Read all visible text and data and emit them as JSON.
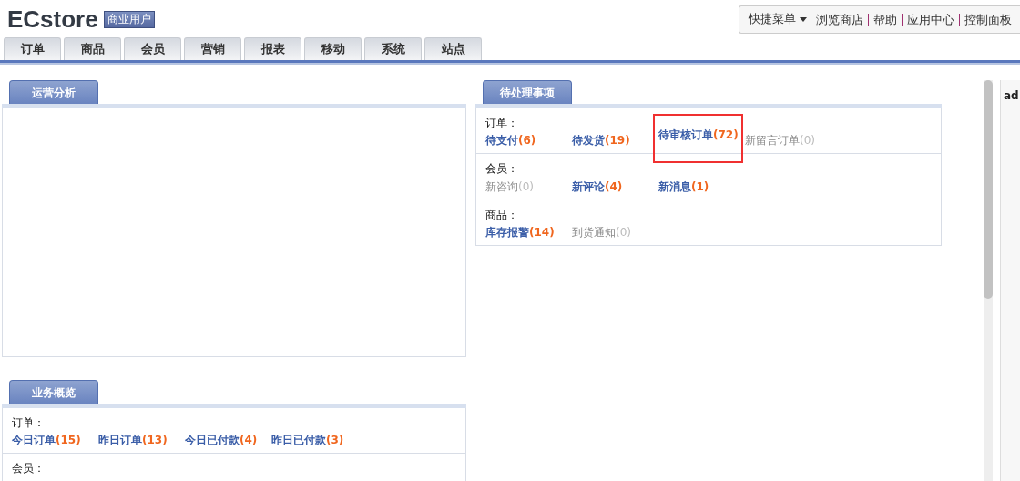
{
  "brand": {
    "name": "ECstore",
    "badge": "商业用户"
  },
  "quick_menu": {
    "label": "快捷菜单"
  },
  "top_links": [
    "浏览商店",
    "帮助",
    "应用中心",
    "控制面板"
  ],
  "tabs": [
    {
      "label": "订单",
      "selected": false
    },
    {
      "label": "商品",
      "selected": false
    },
    {
      "label": "会员",
      "selected": false
    },
    {
      "label": "营销",
      "selected": false
    },
    {
      "label": "报表",
      "selected": false
    },
    {
      "label": "移动",
      "selected": false
    },
    {
      "label": "系统",
      "selected": false
    },
    {
      "label": "站点",
      "selected": false
    }
  ],
  "left_panels": [
    {
      "title": "运营分析"
    },
    {
      "title": "业务概览",
      "sections": [
        {
          "heading": "订单：",
          "items": [
            {
              "label": "今日订单",
              "count": "(15)",
              "active": true,
              "annotated": false
            },
            {
              "label": "昨日订单",
              "count": "(13)",
              "active": true,
              "annotated": false
            },
            {
              "label": "今日已付款",
              "count": "(4)",
              "active": true,
              "annotated": false
            },
            {
              "label": "昨日已付款",
              "count": "(3)",
              "active": true,
              "annotated": false
            }
          ]
        },
        {
          "heading": "会员："
        }
      ]
    }
  ],
  "right_panels": [
    {
      "title": "待处理事项",
      "sections": [
        {
          "heading": "订单：",
          "items": [
            {
              "label": "待支付",
              "count": "(6)",
              "active": true,
              "annotated": false
            },
            {
              "label": "待发货",
              "count": "(19)",
              "active": true,
              "annotated": false
            },
            {
              "label": "待审核订单",
              "count": "(72)",
              "active": true,
              "annotated": true
            },
            {
              "label": "新留言订单",
              "count": "(0)",
              "active": false,
              "annotated": false
            }
          ]
        },
        {
          "heading": "会员：",
          "items": [
            {
              "label": "新咨询",
              "count": "(0)",
              "active": false,
              "annotated": false
            },
            {
              "label": "新评论",
              "count": "(4)",
              "active": true,
              "annotated": false
            },
            {
              "label": "新消息",
              "count": "(1)",
              "active": true,
              "annotated": false
            }
          ]
        },
        {
          "heading": "商品：",
          "items": [
            {
              "label": "库存报警",
              "count": "(14)",
              "active": true,
              "annotated": false
            },
            {
              "label": "到货通知",
              "count": "(0)",
              "active": false,
              "annotated": false
            }
          ]
        }
      ]
    }
  ],
  "side_panel": {
    "title": "ad"
  }
}
